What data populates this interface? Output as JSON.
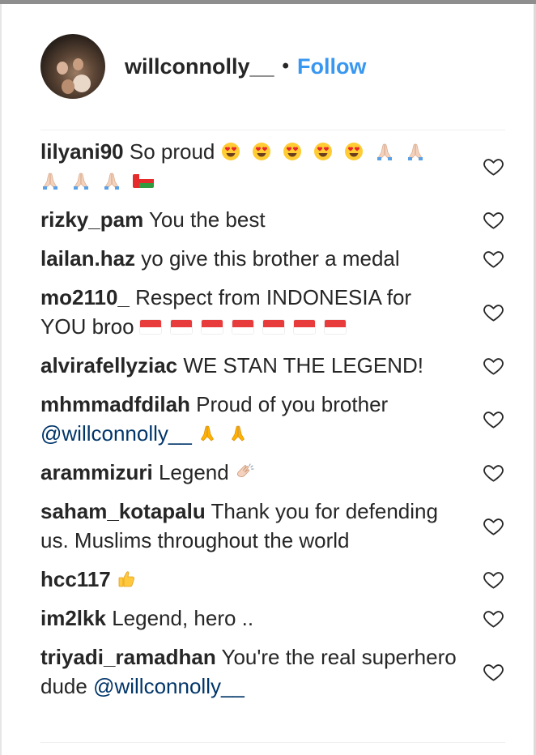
{
  "post_owner": {
    "username": "willconnolly__",
    "separator": "•",
    "follow_label": "Follow"
  },
  "comments": [
    {
      "user": "lilyani90",
      "text": "So proud"
    },
    {
      "user": "rizky_pam",
      "text": "You the best"
    },
    {
      "user": "lailan.haz",
      "text": "yo give this brother a medal"
    },
    {
      "user": "mo2110_",
      "text": "Respect from INDONESIA for YOU broo"
    },
    {
      "user": "alvirafellyziac",
      "text": "WE STAN THE LEGEND!"
    },
    {
      "user": "mhmmadfdilah",
      "text": "Proud of you brother",
      "mention": "@willconnolly__"
    },
    {
      "user": "arammizuri",
      "text": "Legend"
    },
    {
      "user": "saham_kotapalu",
      "text": "Thank you for defending us. Muslims throughout the world"
    },
    {
      "user": "hcc117",
      "text": ""
    },
    {
      "user": "im2lkk",
      "text": "Legend, hero .."
    },
    {
      "user": "triyadi_ramadhan",
      "text": "You're the real superhero dude",
      "mention": "@willconnolly__"
    }
  ],
  "icons": {
    "like": "heart-outline-icon",
    "emojis": [
      "heart-eyes-emoji",
      "folded-hands-emoji",
      "oman-flag-emoji",
      "indonesia-flag-emoji",
      "clapping-hands-emoji",
      "thumbs-up-emoji"
    ]
  },
  "colors": {
    "link": "#3897f0",
    "mention": "#003569",
    "text": "#262626"
  }
}
